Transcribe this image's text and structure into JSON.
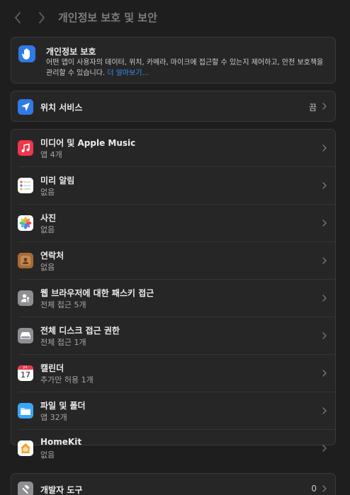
{
  "window": {
    "title": "개인정보 보호 및 보안"
  },
  "privacy_banner": {
    "title": "개인정보 보호",
    "description": "어떤 앱이 사용자의 데이터, 위치, 카메라, 마이크에 접근할 수 있는지 제어하고, 안전 보호책을 관리할 수 있습니다.",
    "link": "더 알아보기...",
    "icon": "hand-raised-icon",
    "accent": "#2f7ae5"
  },
  "location": {
    "label": "위치 서비스",
    "value": "끔",
    "icon": "location-arrow-icon"
  },
  "items": [
    {
      "title": "미디어 및 Apple Music",
      "subtitle": "앱 4개",
      "icon": "music-note-icon",
      "color": "#f0364c"
    },
    {
      "title": "미리 알림",
      "subtitle": "없음",
      "icon": "reminders-icon",
      "color": "#ffffff"
    },
    {
      "title": "사진",
      "subtitle": "없음",
      "icon": "photos-icon",
      "color": "#ffffff"
    },
    {
      "title": "연락처",
      "subtitle": "없음",
      "icon": "contacts-icon",
      "color": "#a86a35"
    },
    {
      "title": "웹 브라우저에 대한 패스키 접근",
      "subtitle": "전체 접근 5개",
      "icon": "passkey-person-icon",
      "color": "#8e8e93"
    },
    {
      "title": "전체 디스크 접근 권한",
      "subtitle": "전체 접근 1개",
      "icon": "disk-drive-icon",
      "color": "#8e8e93"
    },
    {
      "title": "캘린더",
      "subtitle": "추가만 허용 1개",
      "icon": "calendar-icon",
      "color": "#ffffff",
      "calendar_day": "17",
      "calendar_month": "JUL"
    },
    {
      "title": "파일 및 폴더",
      "subtitle": "앱 32개",
      "icon": "folder-icon",
      "color": "#3aa6f5"
    },
    {
      "title": "HomeKit",
      "subtitle": "없음",
      "icon": "home-icon",
      "color": "#ffffff"
    }
  ],
  "developer_tools": {
    "label": "개발자 도구",
    "value": "0",
    "icon": "hammer-icon"
  }
}
